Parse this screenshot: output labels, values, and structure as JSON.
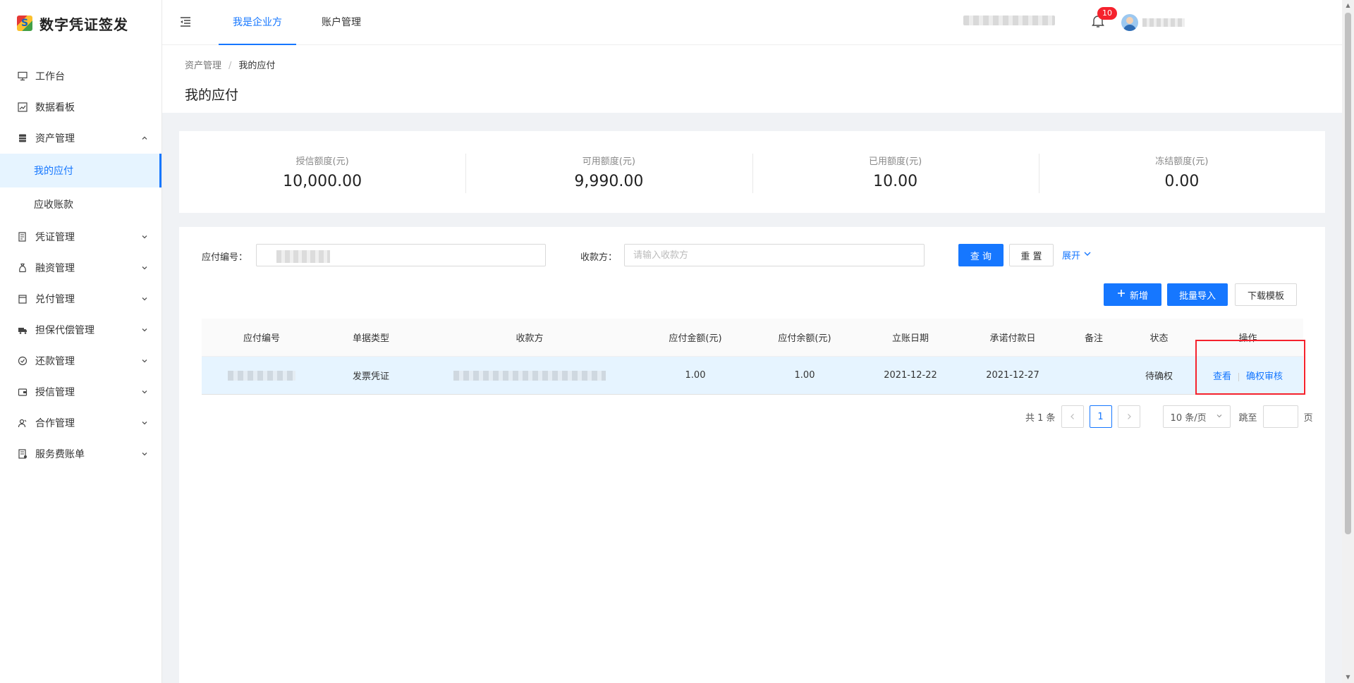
{
  "app": {
    "title": "数字凭证签发"
  },
  "sidebar": {
    "items": [
      {
        "label": "工作台",
        "icon": "monitor-icon"
      },
      {
        "label": "数据看板",
        "icon": "chart-icon"
      },
      {
        "label": "资产管理",
        "icon": "database-icon",
        "expanded": true
      },
      {
        "label": "我的应付",
        "sub": true,
        "active": true
      },
      {
        "label": "应收账款",
        "sub": true
      },
      {
        "label": "凭证管理",
        "icon": "document-icon"
      },
      {
        "label": "融资管理",
        "icon": "money-bag-icon"
      },
      {
        "label": "兑付管理",
        "icon": "calendar-icon"
      },
      {
        "label": "担保代偿管理",
        "icon": "truck-icon"
      },
      {
        "label": "还款管理",
        "icon": "refund-icon"
      },
      {
        "label": "授信管理",
        "icon": "wallet-icon"
      },
      {
        "label": "合作管理",
        "icon": "partner-icon"
      },
      {
        "label": "服务费账单",
        "icon": "bill-icon"
      }
    ]
  },
  "header": {
    "tabs": [
      {
        "label": "我是企业方",
        "active": true
      },
      {
        "label": "账户管理"
      }
    ],
    "notification_count": "10"
  },
  "page": {
    "breadcrumb": [
      "资产管理",
      "我的应付"
    ],
    "title": "我的应付"
  },
  "stats": [
    {
      "label": "授信额度(元)",
      "value": "10,000.00"
    },
    {
      "label": "可用额度(元)",
      "value": "9,990.00"
    },
    {
      "label": "已用额度(元)",
      "value": "10.00"
    },
    {
      "label": "冻结额度(元)",
      "value": "0.00"
    }
  ],
  "filters": {
    "payable_no_label": "应付编号：",
    "payee_label": "收款方：",
    "payee_placeholder": "请输入收款方",
    "query": "查 询",
    "reset": "重 置",
    "expand": "展开"
  },
  "actions": {
    "add": "新增",
    "batch_import": "批量导入",
    "download_template": "下载模板"
  },
  "table": {
    "columns": [
      "应付编号",
      "单据类型",
      "收款方",
      "应付金额(元)",
      "应付余额(元)",
      "立账日期",
      "承诺付款日",
      "备注",
      "状态",
      "操作"
    ],
    "rows": [
      {
        "doc_type": "发票凭证",
        "amount": "1.00",
        "balance": "1.00",
        "entry_date": "2021-12-22",
        "promise_date": "2021-12-27",
        "note": "",
        "status": "待确权",
        "op_view": "查看",
        "op_confirm": "确权审核"
      }
    ]
  },
  "pagination": {
    "total": "共 1 条",
    "current": "1",
    "page_size": "10 条/页",
    "jump_label": "跳至",
    "page_suffix": "页"
  },
  "colors": {
    "primary": "#1677ff",
    "highlight": "#f5222d",
    "row_selected": "#e6f4ff"
  }
}
